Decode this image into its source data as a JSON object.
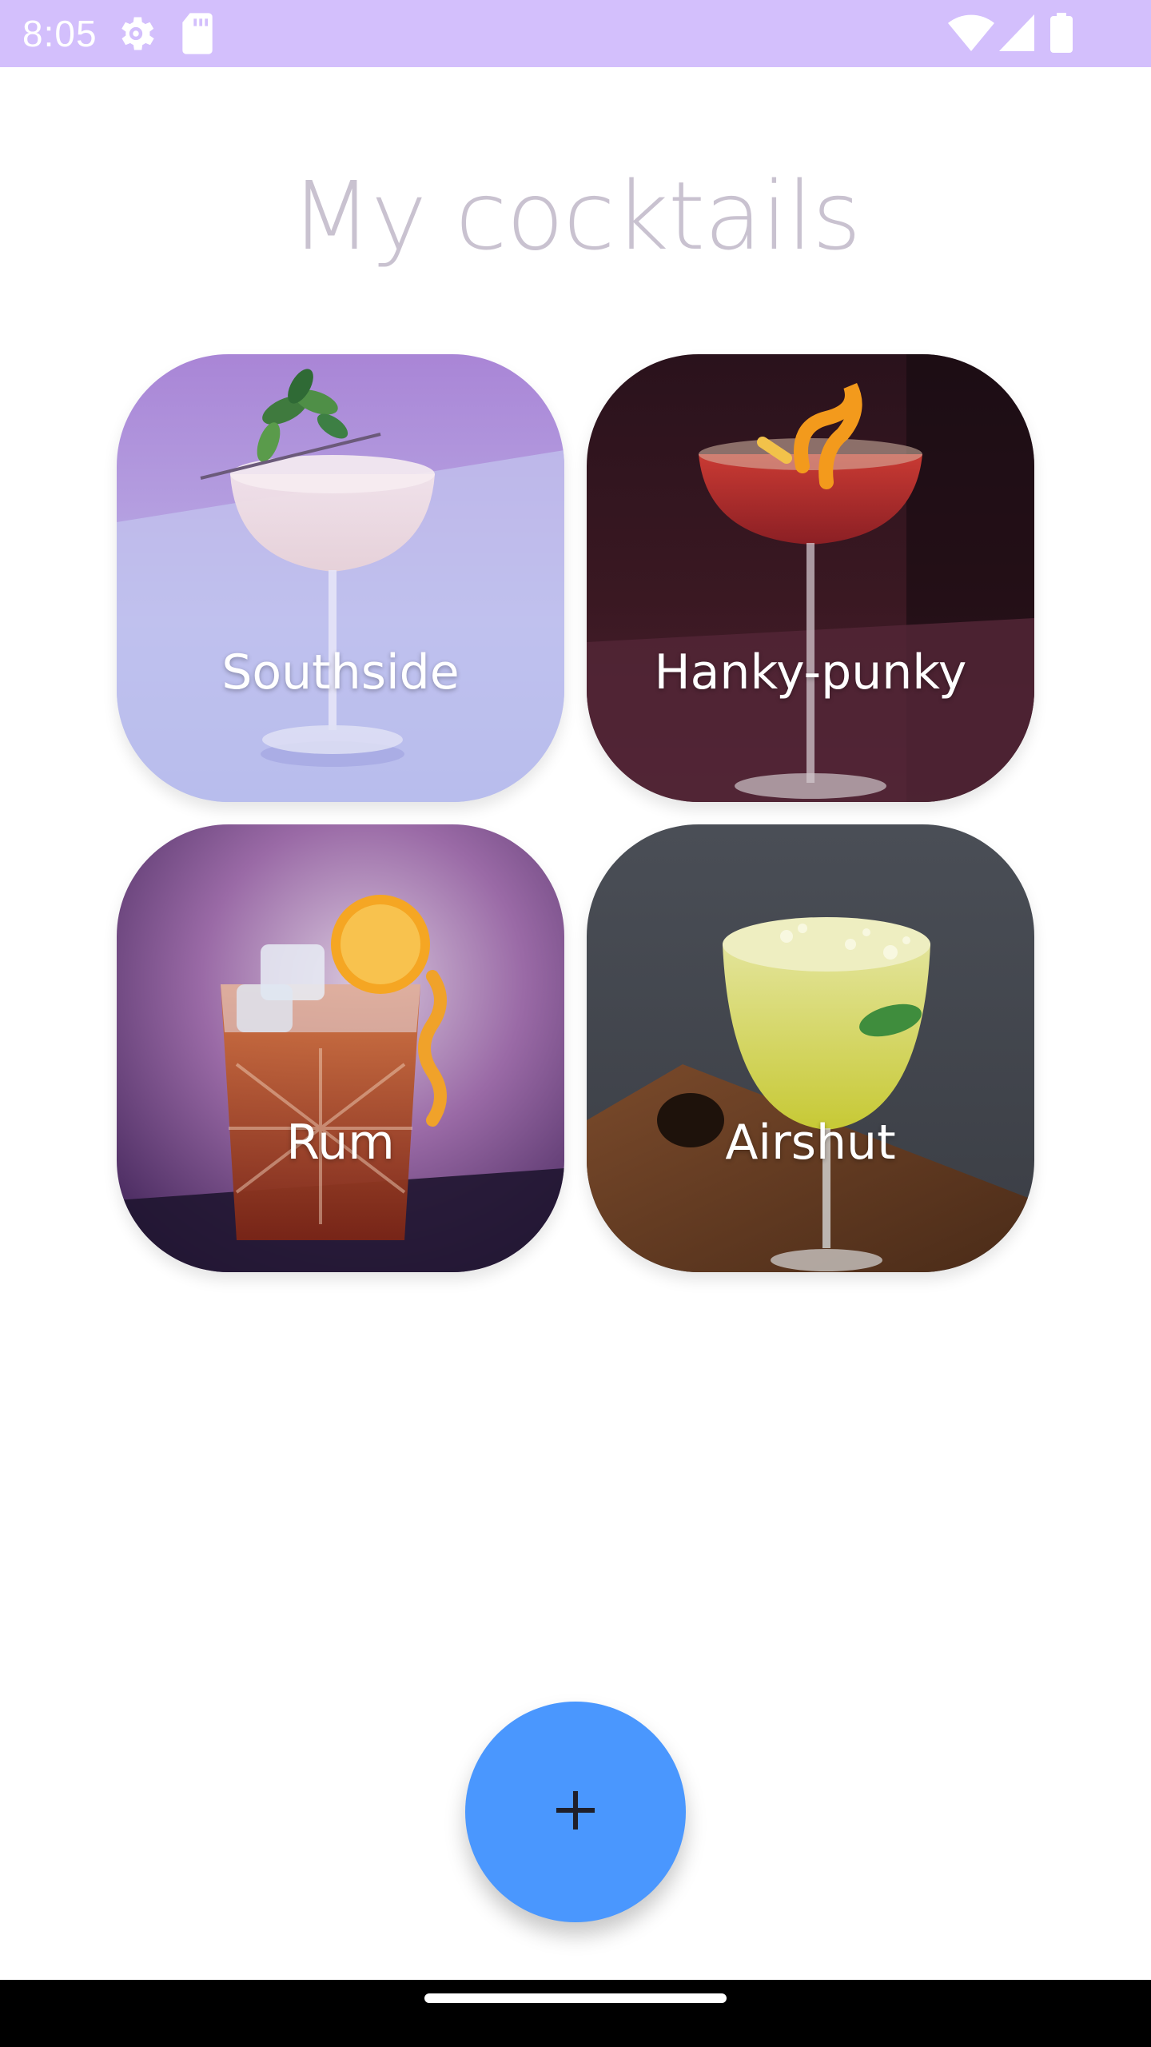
{
  "status_bar": {
    "time": "8:05",
    "icons": [
      "settings-gear-icon",
      "sd-card-icon",
      "wifi-icon",
      "cell-signal-icon",
      "battery-icon"
    ],
    "background": "#d3bffc"
  },
  "header": {
    "title": "My cocktails",
    "title_color": "#c9c2d0"
  },
  "cocktails": [
    {
      "name": "Southside"
    },
    {
      "name": "Hanky-punky"
    },
    {
      "name": "Rum"
    },
    {
      "name": "Airshut"
    }
  ],
  "fab": {
    "icon": "plus-icon",
    "color": "#4a97fe"
  }
}
